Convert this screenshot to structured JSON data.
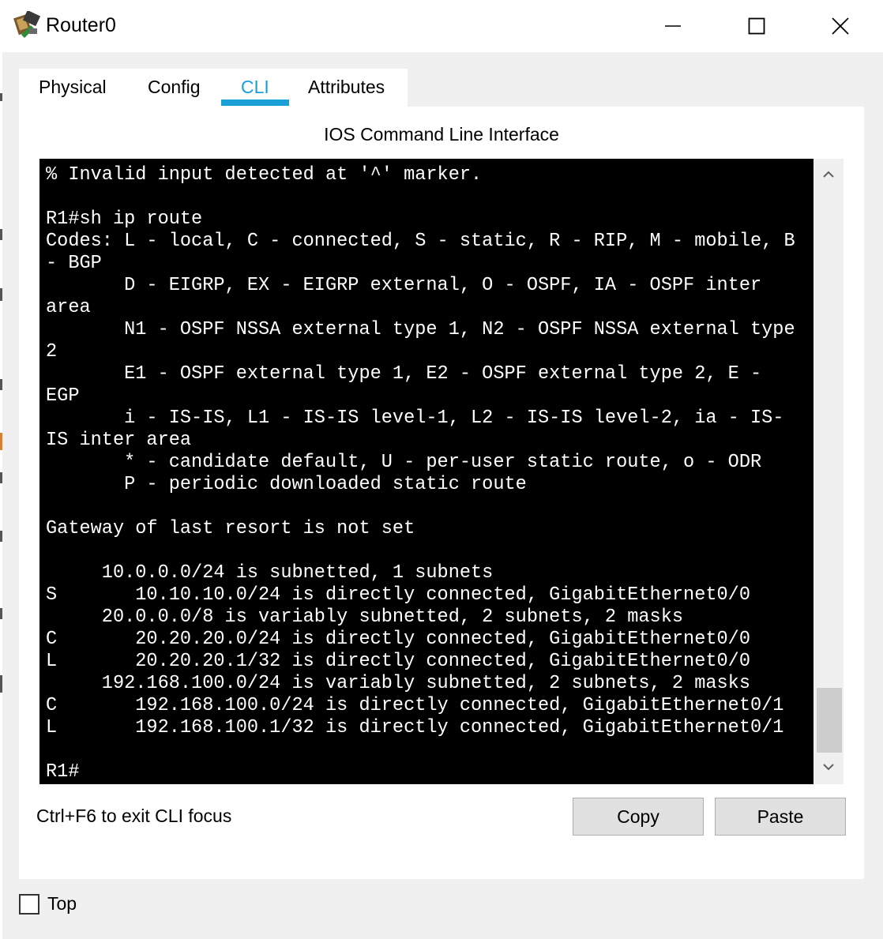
{
  "window": {
    "title": "Router0",
    "icon": "router-icon",
    "controls": [
      "minimize-icon",
      "maximize-icon",
      "close-icon"
    ]
  },
  "tabs": [
    {
      "label": "Physical",
      "active": false
    },
    {
      "label": "Config",
      "active": false
    },
    {
      "label": "CLI",
      "active": true
    },
    {
      "label": "Attributes",
      "active": false
    }
  ],
  "cli": {
    "heading": "IOS Command Line Interface",
    "lines": [
      "% Invalid input detected at '^' marker.",
      "",
      "R1#sh ip route",
      "Codes: L - local, C - connected, S - static, R - RIP, M - mobile, B",
      "- BGP",
      "       D - EIGRP, EX - EIGRP external, O - OSPF, IA - OSPF inter",
      "area",
      "       N1 - OSPF NSSA external type 1, N2 - OSPF NSSA external type",
      "2",
      "       E1 - OSPF external type 1, E2 - OSPF external type 2, E -",
      "EGP",
      "       i - IS-IS, L1 - IS-IS level-1, L2 - IS-IS level-2, ia - IS-",
      "IS inter area",
      "       * - candidate default, U - per-user static route, o - ODR",
      "       P - periodic downloaded static route",
      "",
      "Gateway of last resort is not set",
      "",
      "     10.0.0.0/24 is subnetted, 1 subnets",
      "S       10.10.10.0/24 is directly connected, GigabitEthernet0/0",
      "     20.0.0.0/8 is variably subnetted, 2 subnets, 2 masks",
      "C       20.20.20.0/24 is directly connected, GigabitEthernet0/0",
      "L       20.20.20.1/32 is directly connected, GigabitEthernet0/0",
      "     192.168.100.0/24 is variably subnetted, 2 subnets, 2 masks",
      "C       192.168.100.0/24 is directly connected, GigabitEthernet0/1",
      "L       192.168.100.1/32 is directly connected, GigabitEthernet0/1",
      "",
      "R1#"
    ],
    "focus_hint": "Ctrl+F6 to exit CLI focus",
    "copy_label": "Copy",
    "paste_label": "Paste"
  },
  "footer": {
    "top_label": "Top",
    "top_checked": false
  },
  "colors": {
    "accent": "#1a9fd6",
    "terminal_bg": "#000000",
    "terminal_fg": "#ffffff",
    "window_bg": "#f0f0f0",
    "button_bg": "#e1e1e1"
  }
}
